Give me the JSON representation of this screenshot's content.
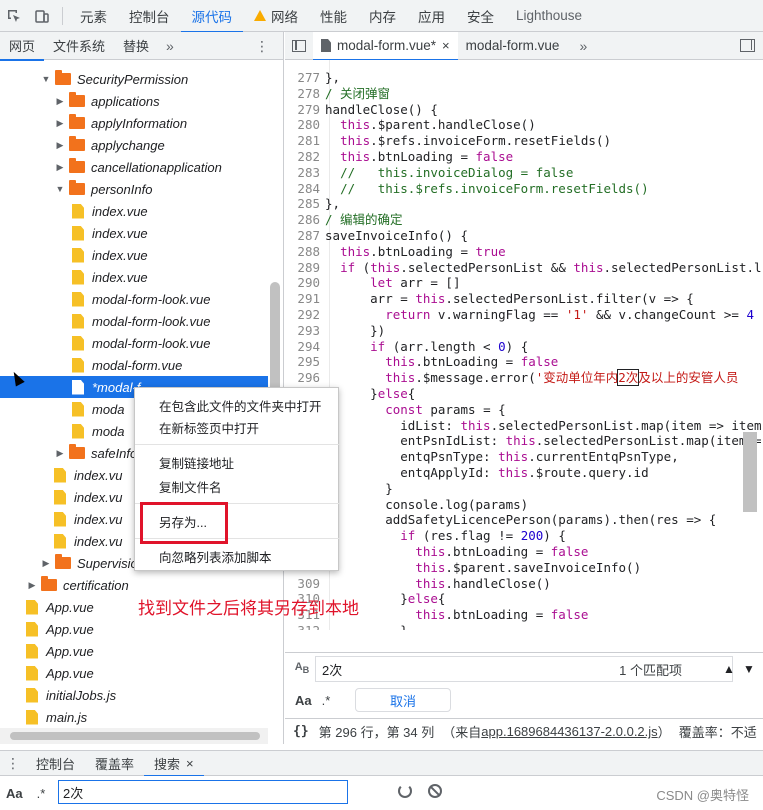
{
  "toolbar": {
    "tabs": [
      "元素",
      "控制台",
      "源代码",
      "网络",
      "性能",
      "内存",
      "应用",
      "安全",
      "Lighthouse"
    ],
    "active_tab": "源代码"
  },
  "navigator": {
    "tabs": [
      "网页",
      "文件系统",
      "替换"
    ],
    "more": "»",
    "tree": [
      {
        "label": "SecurityPermission",
        "type": "folder",
        "expanded": true
      },
      {
        "label": "applications",
        "type": "folder",
        "expanded": false
      },
      {
        "label": "applyInformation",
        "type": "folder",
        "expanded": false
      },
      {
        "label": "applychange",
        "type": "folder",
        "expanded": false
      },
      {
        "label": "cancellationapplication",
        "type": "folder",
        "expanded": false
      },
      {
        "label": "personInfo",
        "type": "folder",
        "expanded": true
      },
      {
        "label": "index.vue",
        "type": "file"
      },
      {
        "label": "index.vue",
        "type": "file"
      },
      {
        "label": "index.vue",
        "type": "file"
      },
      {
        "label": "index.vue",
        "type": "file"
      },
      {
        "label": "modal-form-look.vue",
        "type": "file"
      },
      {
        "label": "modal-form-look.vue",
        "type": "file"
      },
      {
        "label": "modal-form-look.vue",
        "type": "file"
      },
      {
        "label": "modal-form.vue",
        "type": "file"
      },
      {
        "label": "*modal-f",
        "type": "file",
        "selected": true
      },
      {
        "label": "moda",
        "type": "file"
      },
      {
        "label": "moda",
        "type": "file"
      },
      {
        "label": "safeInfo",
        "type": "folder",
        "expanded": false
      },
      {
        "label": "index.vu",
        "type": "file"
      },
      {
        "label": "index.vu",
        "type": "file"
      },
      {
        "label": "index.vu",
        "type": "file"
      },
      {
        "label": "index.vu",
        "type": "file"
      },
      {
        "label": "Supervisio",
        "type": "folder",
        "expanded": false
      },
      {
        "label": "certification",
        "type": "folder",
        "expanded": false
      },
      {
        "label": "App.vue",
        "type": "file"
      },
      {
        "label": "App.vue",
        "type": "file"
      },
      {
        "label": "App.vue",
        "type": "file"
      },
      {
        "label": "App.vue",
        "type": "file"
      },
      {
        "label": "initialJobs.js",
        "type": "file"
      },
      {
        "label": "main.js",
        "type": "file"
      }
    ]
  },
  "editor": {
    "tabs": [
      {
        "label": "modal-form.vue*",
        "active": true,
        "close": "×"
      },
      {
        "label": "modal-form.vue",
        "active": false
      }
    ],
    "more": "»",
    "lines": [
      {
        "n": "277",
        "t": "},"
      },
      {
        "n": "278",
        "t": "/ 关闭弹窗"
      },
      {
        "n": "279",
        "t": "handleClose() {"
      },
      {
        "n": "280",
        "t": "  this.$parent.handleClose()"
      },
      {
        "n": "281",
        "t": "  this.$refs.invoiceForm.resetFields()"
      },
      {
        "n": "282",
        "t": "  this.btnLoading = false"
      },
      {
        "n": "283",
        "t": "  //   this.invoiceDialog = false"
      },
      {
        "n": "284",
        "t": "  //   this.$refs.invoiceForm.resetFields()"
      },
      {
        "n": "285",
        "t": "},"
      },
      {
        "n": "286",
        "t": "/ 编辑的确定"
      },
      {
        "n": "287",
        "t": "saveInvoiceInfo() {"
      },
      {
        "n": "288",
        "t": "  this.btnLoading = true"
      },
      {
        "n": "289",
        "t": "  if (this.selectedPersonList && this.selectedPersonList.l"
      },
      {
        "n": "290",
        "t": "      let arr = []"
      },
      {
        "n": "291",
        "t": "      arr = this.selectedPersonList.filter(v => {"
      },
      {
        "n": "292",
        "t": "        return v.warningFlag == '1' && v.changeCount >= 4"
      },
      {
        "n": "293",
        "t": "      })"
      },
      {
        "n": "294",
        "t": "      if (arr.length < 0) {"
      },
      {
        "n": "295",
        "t": "        this.btnLoading = false"
      },
      {
        "n": "296",
        "t": "        this.$message.error('变动单位年内2次及以上的安管人员"
      },
      {
        "n": "",
        "t": "      }else{"
      },
      {
        "n": "",
        "t": "        const params = {"
      },
      {
        "n": "",
        "t": "          idList: this.selectedPersonList.map(item => item"
      },
      {
        "n": "",
        "t": "          entPsnIdList: this.selectedPersonList.map(item ="
      },
      {
        "n": "",
        "t": "          entqPsnType: this.currentEntqPsnType,"
      },
      {
        "n": "",
        "t": "          entqApplyId: this.$route.query.id"
      },
      {
        "n": "",
        "t": "        }"
      },
      {
        "n": "",
        "t": "        console.log(params)"
      },
      {
        "n": "",
        "t": "        addSafetyLicencePerson(params).then(res => {"
      },
      {
        "n": "",
        "t": "          if (res.flag != 200) {"
      },
      {
        "n": "",
        "t": "            this.btnLoading = false"
      },
      {
        "n": "",
        "t": "            this.$parent.saveInvoiceInfo()"
      },
      {
        "n": "309",
        "t": "            this.handleClose()"
      },
      {
        "n": "310",
        "t": "          }else{"
      },
      {
        "n": "311",
        "t": "            this.btnLoading = false"
      },
      {
        "n": "312",
        "t": "          }"
      }
    ]
  },
  "find": {
    "icon": "A͟B",
    "query": "2次",
    "count": "1 个匹配项",
    "up": "▲",
    "down": "▼"
  },
  "replace": {
    "aa": "Aa",
    "regex": ".*",
    "cancel": "取消"
  },
  "status": {
    "braces": "{}",
    "position": "第 296 行，第 34 列",
    "source_prefix": "（来自",
    "source_link": "app.1689684436137-2.0.0.2.js",
    "source_suffix": "）",
    "coverage": "覆盖率：不适"
  },
  "context_menu": {
    "items": [
      "在包含此文件的文件夹中打开",
      "在新标签页中打开",
      "复制链接地址",
      "复制文件名",
      "另存为...",
      "向忽略列表添加脚本"
    ]
  },
  "annotation": "找到文件之后将其另存到本地",
  "drawer": {
    "tabs": [
      "控制台",
      "覆盖率",
      "搜索"
    ],
    "active": "搜索",
    "close": "×"
  },
  "search": {
    "aa": "Aa",
    "regex": ".*",
    "query": "2次"
  },
  "watermark": "CSDN @奥特怪",
  "colors": {
    "accent": "#1a73e8",
    "folder": "#f2721c",
    "file": "#f6c026",
    "annotation_red": "#e0132a"
  }
}
